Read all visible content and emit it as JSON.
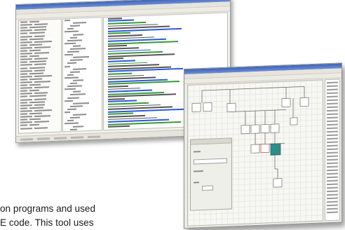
{
  "caption": {
    "line1": "on programs and used",
    "line2": "E code. This tool uses"
  },
  "colors": {
    "titlebar": "#3d63b8",
    "code_keyword": "#2a5bd7",
    "code_comment": "#3a9a3a",
    "code_text": "#555555",
    "node_highlight": "#2e8b8b",
    "node_red": "#d04040"
  }
}
